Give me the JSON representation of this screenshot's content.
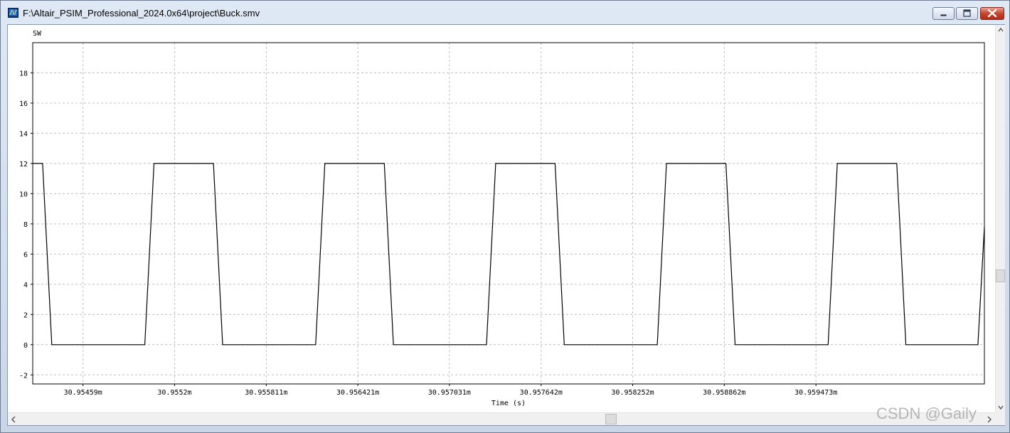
{
  "window": {
    "title": "F:\\Altair_PSIM_Professional_2024.0x64\\project\\Buck.smv"
  },
  "watermark": "CSDN @Gaily",
  "icons": {
    "app": "psim-waveform-icon",
    "minimize": "minimize-icon",
    "maximize": "maximize-icon",
    "close": "close-icon"
  },
  "colors": {
    "waveform": "#000000",
    "grid": "#c0c0c0",
    "close_button": "#c7432e"
  },
  "chart_data": {
    "type": "line",
    "title": "",
    "series": [
      {
        "name": "SW",
        "points": [
          [
            30.954255,
            12
          ],
          [
            30.954321,
            12
          ],
          [
            30.954382,
            0
          ],
          [
            30.955002,
            0
          ],
          [
            30.955063,
            12
          ],
          [
            30.955459,
            12
          ],
          [
            30.95552,
            0
          ],
          [
            30.95614,
            0
          ],
          [
            30.956201,
            12
          ],
          [
            30.956597,
            12
          ],
          [
            30.956658,
            0
          ],
          [
            30.957278,
            0
          ],
          [
            30.957339,
            12
          ],
          [
            30.957735,
            12
          ],
          [
            30.957796,
            0
          ],
          [
            30.958416,
            0
          ],
          [
            30.958477,
            12
          ],
          [
            30.958873,
            12
          ],
          [
            30.958934,
            0
          ],
          [
            30.959554,
            0
          ],
          [
            30.959615,
            12
          ],
          [
            30.960011,
            12
          ],
          [
            30.960072,
            0
          ],
          [
            30.960552,
            0
          ],
          [
            30.960595,
            7.8
          ]
        ]
      }
    ],
    "xlabel": "Time (s)",
    "ylabel": "",
    "xlim": [
      30.954255,
      30.960595
    ],
    "ylim": [
      -2.6,
      20
    ],
    "x_ticks": [
      30.95459,
      30.9552,
      30.955811,
      30.956421,
      30.957031,
      30.957642,
      30.958252,
      30.958862,
      30.959473
    ],
    "x_tick_labels": [
      "30.95459m",
      "30.9552m",
      "30.955811m",
      "30.956421m",
      "30.957031m",
      "30.957642m",
      "30.958252m",
      "30.958862m",
      "30.959473m"
    ],
    "y_ticks": [
      -2,
      0,
      2,
      4,
      6,
      8,
      10,
      12,
      14,
      16,
      18
    ],
    "y_tick_labels": [
      "-2",
      "0",
      "2",
      "4",
      "6",
      "8",
      "10",
      "12",
      "14",
      "16",
      "18"
    ],
    "grid": true,
    "legend": "top-left"
  }
}
